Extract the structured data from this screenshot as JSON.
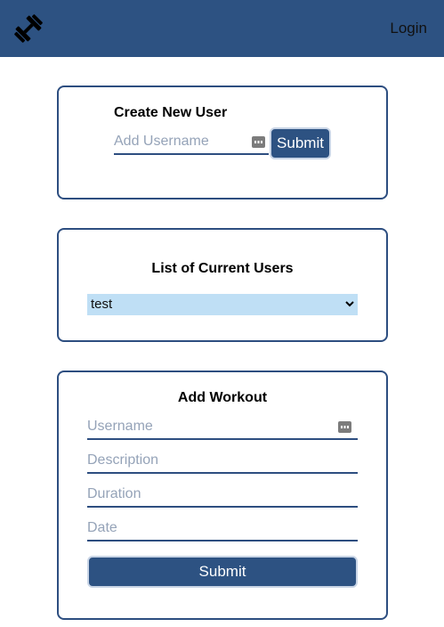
{
  "navbar": {
    "logo_icon": "dumbbell-icon",
    "login_label": "Login"
  },
  "create_user": {
    "title": "Create New User",
    "username_placeholder": "Add Username",
    "username_value": "",
    "submit_label": "Submit"
  },
  "user_list": {
    "title": "List of Current Users",
    "selected_user": "test"
  },
  "add_workout": {
    "title": "Add Workout",
    "username_placeholder": "Username",
    "description_placeholder": "Description",
    "duration_placeholder": "Duration",
    "date_placeholder": "Date",
    "submit_label": "Submit"
  },
  "colors": {
    "navbar": "#2d5282",
    "accent": "#2d4e80",
    "select_bg": "#bfdff5",
    "placeholder": "#95a3b8"
  }
}
